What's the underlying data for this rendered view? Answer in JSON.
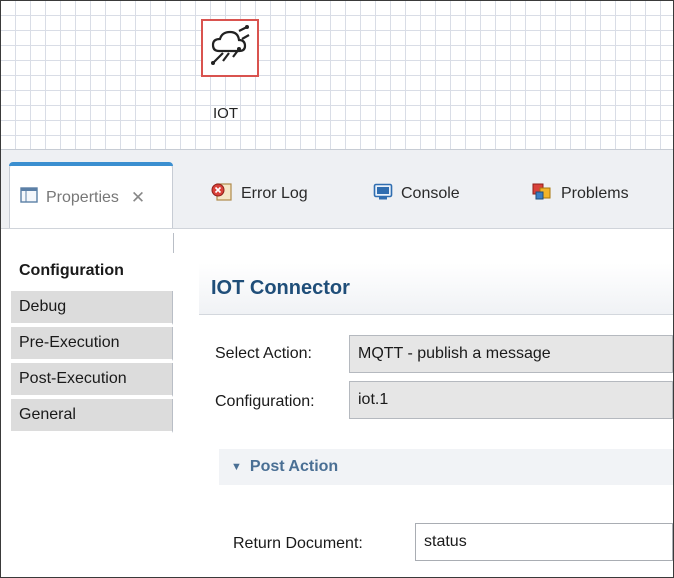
{
  "canvas": {
    "node_label": "IOT",
    "node_border_color": "#d9534f",
    "node_icon": "cloud-connect-icon"
  },
  "tabs": [
    {
      "label": "Properties",
      "icon": "properties-icon",
      "active": true
    },
    {
      "label": "Error Log",
      "icon": "error-log-icon",
      "active": false
    },
    {
      "label": "Console",
      "icon": "console-icon",
      "active": false
    },
    {
      "label": "Problems",
      "icon": "problems-icon",
      "active": false
    }
  ],
  "sidebar": {
    "items": [
      {
        "label": "Configuration",
        "active": true
      },
      {
        "label": "Debug"
      },
      {
        "label": "Pre-Execution"
      },
      {
        "label": "Post-Execution"
      },
      {
        "label": "General"
      }
    ]
  },
  "main": {
    "title": "IOT Connector",
    "select_action_label": "Select Action:",
    "select_action_value": "MQTT - publish a message",
    "configuration_label": "Configuration:",
    "configuration_value": "iot.1",
    "post_action_label": "Post Action",
    "return_document_label": "Return Document:",
    "return_document_value": "status"
  },
  "colors": {
    "title": "#1f4e79",
    "active_tab_accent": "#3b8fd0",
    "post_action": "#4a6f94"
  }
}
